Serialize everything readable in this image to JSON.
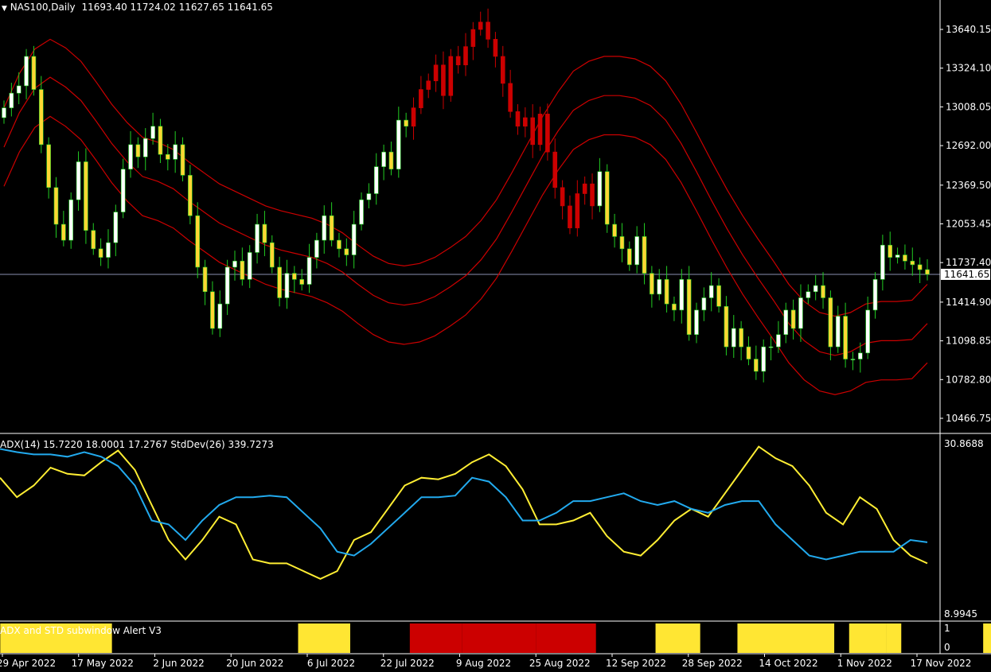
{
  "header": {
    "symbol_label": "NAS100,Daily",
    "ohlc": "11693.40 11724.02 11627.65 11641.65"
  },
  "indicator_label": "ADX(14) 15.7220 18.0001 17.2767  StdDev(26) 339.7273",
  "alert_label": "ADX and STD subwindow Alert V3",
  "current_price": "11641.65",
  "colors": {
    "background": "#000000",
    "bull_candle": "#ffffff",
    "bear_candle": "#ffd733",
    "bull_wick": "#22cc22",
    "red_candle": "#cc0000",
    "envelope": "#cc0000",
    "adx_line": "#ffee33",
    "std_line": "#22aaee",
    "price_line": "#8a8fb0",
    "alert_yellow": "#ffe633",
    "alert_red": "#cc0000"
  },
  "chart_data": [
    {
      "type": "candlestick",
      "title": "NAS100,Daily",
      "ylim": [
        10300,
        13900
      ],
      "yticks": [
        "13640.15",
        "13324.10",
        "13008.05",
        "12692.00",
        "12369.50",
        "12053.45",
        "11737.40",
        "11414.90",
        "11098.85",
        "10782.80",
        "10466.75"
      ],
      "x": [
        "29 Apr 2022",
        "17 May 2022",
        "2 Jun 2022",
        "20 Jun 2022",
        "6 Jul 2022",
        "22 Jul 2022",
        "9 Aug 2022",
        "25 Aug 2022",
        "12 Sep 2022",
        "28 Sep 2022",
        "14 Oct 2022",
        "1 Nov 2022",
        "17 Nov 2022"
      ],
      "closes": [
        13000,
        13120,
        13180,
        13420,
        13150,
        12700,
        12350,
        12050,
        11920,
        12250,
        12560,
        12000,
        11850,
        11780,
        11900,
        12150,
        12500,
        12700,
        12600,
        12750,
        12850,
        12620,
        12580,
        12700,
        12450,
        12120,
        11700,
        11500,
        11200,
        11400,
        11700,
        11750,
        11600,
        11820,
        12050,
        11900,
        11700,
        11450,
        11650,
        11600,
        11560,
        11780,
        11920,
        12120,
        11920,
        11850,
        11800,
        12050,
        12250,
        12300,
        12520,
        12640,
        12500,
        12900,
        12850,
        13000,
        13150,
        13220,
        13350,
        13100,
        13420,
        13350,
        13500,
        13640,
        13700,
        13560,
        13420,
        13200,
        12970,
        12850,
        12920,
        12700,
        12950,
        12640,
        12350,
        12200,
        12020,
        12300,
        12380,
        12200,
        12480,
        12050,
        11950,
        11850,
        11720,
        11950,
        11650,
        11480,
        11600,
        11400,
        11350,
        11600,
        11150,
        11350,
        11450,
        11550,
        11380,
        11050,
        11200,
        11050,
        10950,
        10850,
        11050,
        11050,
        11150,
        11350,
        11200,
        11450,
        11500,
        11550,
        11450,
        11050,
        11300,
        10950,
        10950,
        11000,
        11350,
        11600,
        11880,
        11780,
        11800,
        11750,
        11720,
        11680,
        11641.65
      ],
      "series": [
        {
          "values": [
            13000,
            13280,
            13480,
            13560,
            13490,
            13380,
            13210,
            13030,
            12880,
            12760,
            12720,
            12660,
            12560,
            12470,
            12380,
            12320,
            12260,
            12200,
            12160,
            12130,
            12100,
            12050,
            11980,
            11880,
            11790,
            11730,
            11710,
            11730,
            11780,
            11860,
            11950,
            12080,
            12250,
            12470,
            12700,
            12930,
            13130,
            13300,
            13380,
            13420,
            13420,
            13400,
            13340,
            13220,
            13030,
            12800,
            12560,
            12330,
            12120,
            11930,
            11750,
            11560,
            11420,
            11330,
            11300,
            11330,
            11400,
            11420,
            11420,
            11430,
            11560
          ]
        },
        {
          "values": [
            12680,
            12960,
            13160,
            13250,
            13170,
            13060,
            12890,
            12710,
            12560,
            12440,
            12400,
            12340,
            12240,
            12150,
            12060,
            12000,
            11940,
            11880,
            11840,
            11810,
            11780,
            11730,
            11660,
            11560,
            11470,
            11410,
            11390,
            11410,
            11460,
            11540,
            11630,
            11760,
            11930,
            12150,
            12380,
            12610,
            12810,
            12980,
            13060,
            13100,
            13100,
            13080,
            13020,
            12900,
            12710,
            12480,
            12240,
            12010,
            11800,
            11610,
            11430,
            11240,
            11100,
            11010,
            10980,
            11010,
            11080,
            11100,
            11100,
            11110,
            11240
          ]
        },
        {
          "values": [
            12360,
            12640,
            12840,
            12930,
            12850,
            12740,
            12570,
            12390,
            12240,
            12120,
            12080,
            12020,
            11920,
            11830,
            11740,
            11680,
            11620,
            11560,
            11520,
            11490,
            11460,
            11410,
            11340,
            11240,
            11150,
            11090,
            11070,
            11090,
            11140,
            11220,
            11310,
            11440,
            11610,
            11830,
            12060,
            12290,
            12490,
            12660,
            12740,
            12780,
            12780,
            12760,
            12700,
            12580,
            12390,
            12160,
            11920,
            11690,
            11480,
            11290,
            11110,
            10920,
            10780,
            10690,
            10660,
            10690,
            10760,
            10780,
            10780,
            10790,
            10920
          ]
        }
      ]
    },
    {
      "type": "line",
      "title": "ADX(14) 15.7220 18.0001 17.2767  StdDev(26) 339.7273",
      "ylim": [
        8.9945,
        30.8688
      ],
      "yticks": [
        "30.8688",
        "8.9945"
      ],
      "series": [
        {
          "name": "ADX(14)",
          "values": [
            26.5,
            24.0,
            25.5,
            27.8,
            27.0,
            26.8,
            28.5,
            30.0,
            27.5,
            23.0,
            18.5,
            16.0,
            18.5,
            21.5,
            20.5,
            16.0,
            15.5,
            15.5,
            14.5,
            13.5,
            14.5,
            18.5,
            19.5,
            22.5,
            25.5,
            26.5,
            26.3,
            27.0,
            28.5,
            29.5,
            28.0,
            25.0,
            20.5,
            20.5,
            21.0,
            22.0,
            19.0,
            17.0,
            16.5,
            18.5,
            21.0,
            22.5,
            21.5,
            24.5,
            27.5,
            30.5,
            29.0,
            28.0,
            25.5,
            22.0,
            20.5,
            24.0,
            22.5,
            18.5,
            16.5,
            15.5
          ]
        },
        {
          "name": "StdDev(26)",
          "values": [
            30.2,
            29.8,
            29.5,
            29.5,
            29.2,
            29.8,
            29.2,
            28.0,
            25.5,
            21.0,
            20.5,
            18.5,
            21.0,
            23.0,
            24.0,
            24.0,
            24.2,
            24.0,
            22.0,
            20.0,
            17.0,
            16.5,
            18.0,
            20.0,
            22.0,
            24.0,
            24.0,
            24.2,
            26.5,
            26.0,
            24.0,
            21.0,
            21.0,
            22.0,
            23.5,
            23.5,
            24.0,
            24.5,
            23.5,
            23.0,
            23.5,
            22.5,
            22.0,
            23.0,
            23.5,
            23.5,
            20.5,
            18.5,
            16.5,
            16.0,
            16.5,
            17.0,
            17.0,
            17.0,
            18.5,
            18.2
          ]
        }
      ]
    },
    {
      "type": "histogram",
      "title": "ADX and STD subwindow Alert V3",
      "ylim": [
        0,
        1
      ],
      "yticks": [
        "1",
        "0"
      ],
      "blocks": [
        {
          "start": 0,
          "end": 14,
          "color": "yellow"
        },
        {
          "start": 40,
          "end": 46,
          "color": "yellow"
        },
        {
          "start": 55,
          "end": 61,
          "color": "red"
        },
        {
          "start": 62,
          "end": 71,
          "color": "red"
        },
        {
          "start": 72,
          "end": 79,
          "color": "red"
        },
        {
          "start": 88,
          "end": 93,
          "color": "yellow"
        },
        {
          "start": 99,
          "end": 111,
          "color": "yellow"
        },
        {
          "start": 114,
          "end": 118,
          "color": "yellow"
        },
        {
          "start": 119,
          "end": 120,
          "color": "yellow"
        },
        {
          "start": 132,
          "end": 136,
          "color": "yellow"
        }
      ]
    }
  ]
}
